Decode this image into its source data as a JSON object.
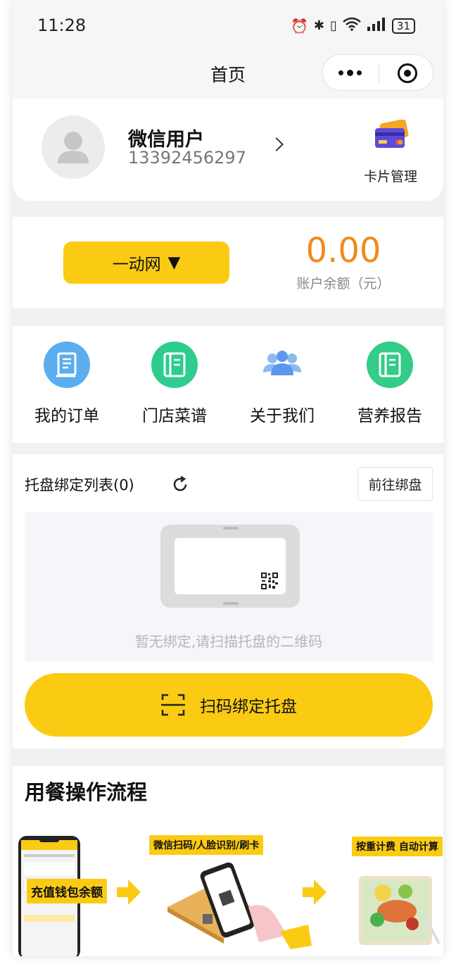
{
  "status_bar": {
    "time": "11:28",
    "battery": "31"
  },
  "nav": {
    "title": "首页"
  },
  "user": {
    "name": "微信用户",
    "phone": "13392456297",
    "card_management_label": "卡片管理"
  },
  "balance": {
    "org_label": "一动网",
    "org_dropdown_glyph": "▼",
    "amount": "0.00",
    "amount_label": "账户余额（元）"
  },
  "menu": {
    "items": [
      {
        "label": "我的订单",
        "icon": "orders-book-icon",
        "color": "#5aaef0"
      },
      {
        "label": "门店菜谱",
        "icon": "menu-book-icon",
        "color": "#2ecc8f"
      },
      {
        "label": "关于我们",
        "icon": "people-group-icon",
        "color": "#6fa6ef"
      },
      {
        "label": "营养报告",
        "icon": "report-book-icon",
        "color": "#33cc88"
      }
    ]
  },
  "tray": {
    "title": "托盘绑定列表(0)",
    "goto_button": "前往绑盘",
    "empty_text": "暂无绑定,请扫描托盘的二维码",
    "scan_button": "扫码绑定托盘"
  },
  "flow": {
    "title": "用餐操作流程",
    "step1_tag": "充值钱包余额",
    "step2_tag": "微信扫码/人脸识别/刷卡",
    "step3_tag": "按重计费  自动计算"
  },
  "colors": {
    "accent_yellow": "#fbcb14",
    "amount_orange": "#f08a1c"
  }
}
